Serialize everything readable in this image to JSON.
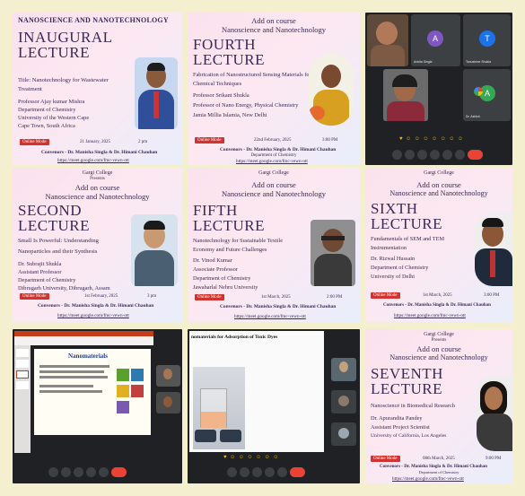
{
  "tile1": {
    "header": "NANOSCIENCE AND NANOTECHNOLOGY",
    "lecture_line1": "INAUGURAL",
    "lecture_line2": "LECTURE",
    "title": "Title: Nanotechnology for Wastewater",
    "title2": "Treatment",
    "speaker": "Professor Ajay kumar Mishra",
    "dept": "Department of Chemistry",
    "univ": "University of the Western Cape",
    "city": "Cape Town, South Africa",
    "mode": "Online Mode",
    "date": "21 January, 2025",
    "time": "2 pm",
    "convenors": "Convenors - Dr. Manisha Singla & Dr. Himani Chauhan",
    "link": "https://meet.google.com/fmc-vewn-ott"
  },
  "tile2": {
    "addon": "Add on course",
    "course": "Nanoscience and Nanotechnology",
    "lecture_line1": "FOURTH",
    "lecture_line2": "LECTURE",
    "t1": "Fabrication of Nanostructured Sensing Materials for",
    "t2": "Chemical Techniques",
    "speaker": "Professor Srikant Shukla",
    "dept": "Professor of Nano Energy, Physical Chemistry",
    "univ": "Jamia Millia Islamia, New Delhi",
    "mode": "Online Mode",
    "date": "22nd February, 2025",
    "time": "3:00 PM",
    "convenors": "Convenors - Dr. Manisha Singla & Dr. Himani Chauhan",
    "dept2": "Department of Chemistry",
    "college": "Gargi College",
    "link": "https://meet.google.com/fmc-vewn-ott"
  },
  "tile3": {
    "participants": [
      {
        "initial": "A",
        "name": "Ankita Singla",
        "color": "#7e57c2"
      },
      {
        "initial": "T",
        "name": "Tanushree Shukla",
        "color": "#1a73e8"
      },
      {
        "initial": "A",
        "name": "Dr. Ashish",
        "color": "#34a853"
      }
    ]
  },
  "tile4": {
    "college": "Gargi College",
    "presents": "Presents",
    "addon": "Add on course",
    "course": "Nanoscience and Nanotechnology",
    "lecture_line1": "SECOND",
    "lecture_line2": "LECTURE",
    "t1": "Small Is Powerful: Understanding",
    "t2": "Nanoparticles and their Synthesis",
    "speaker": "Dr. Subrajit Shukla",
    "role": "Assistant Professor",
    "dept": "Department of Chemistry",
    "univ": "Dibrugarh University, Dibrugarh, Assam",
    "mode": "Online Mode",
    "date": "1st February, 2025",
    "time": "3 pm",
    "convenors": "Convenors - Dr. Manisha Singla & Dr. Himani Chauhan",
    "link": "https://meet.google.com/fmc-vewn-ott"
  },
  "tile5": {
    "college": "Gargi College",
    "addon": "Add on course",
    "course": "Nanoscience and Nanotechnology",
    "lecture_line1": "FIFTH",
    "lecture_line2": "LECTURE",
    "t1": "Nanotechnology for Sustainable Textile",
    "t2": "Economy and Future Challenges",
    "speaker": "Dr. Vinod Kumar",
    "role": "Associate Professor",
    "dept": "Department of Chemistry",
    "univ": "Jawaharlal Nehru University",
    "mode": "Online Mode",
    "date": "1st March, 2025",
    "time": "2:00 PM",
    "convenors": "Convenors - Dr. Manisha Singla & Dr. Himani Chauhan",
    "link": "https://meet.google.com/fmc-vewn-ott"
  },
  "tile6": {
    "college": "Gargi College",
    "addon": "Add on course",
    "course": "Nanoscience and Nanotechnology",
    "lecture_line1": "SIXTH",
    "lecture_line2": "LECTURE",
    "t1": "Fundamentals of SEM and TEM",
    "t2": "Instrumentation",
    "speaker": "Dr. Rizwal Hussain",
    "dept": "Department of Chemistry",
    "univ": "University of Delhi",
    "mode": "Online Mode",
    "date": "1st March, 2025",
    "time": "3:00 PM",
    "convenors": "Convenors - Dr. Manisha Singla & Dr. Himani Chauhan",
    "link": "https://meet.google.com/fmc-vewn-ott"
  },
  "tile7": {
    "slide_title": "Nanomaterials"
  },
  "tile8": {
    "slide_title": "nomaterials for Adsorption of Toxic Dyes"
  },
  "tile9": {
    "college": "Gargi College",
    "presents": "Presents",
    "addon": "Add on course",
    "course": "Nanoscience and Nanotechnology",
    "lecture_line1": "SEVENTH",
    "lecture_line2": "LECTURE",
    "t1": "Nanoscience in Biomedical Research",
    "speaker": "Dr. Apurandita Pandey",
    "role": "Assistant Project Scientist",
    "univ": "University of California, Los Angeles",
    "mode": "Online Mode",
    "date": "08th March, 2025",
    "time": "9:00 PM",
    "convenors": "Convenors - Dr. Manisha Singla & Dr. Himani Chauhan",
    "dept": "Department of Chemistry",
    "college2": "Gargi College",
    "link": "https://meet.google.com/fmc-vewn-ott"
  }
}
